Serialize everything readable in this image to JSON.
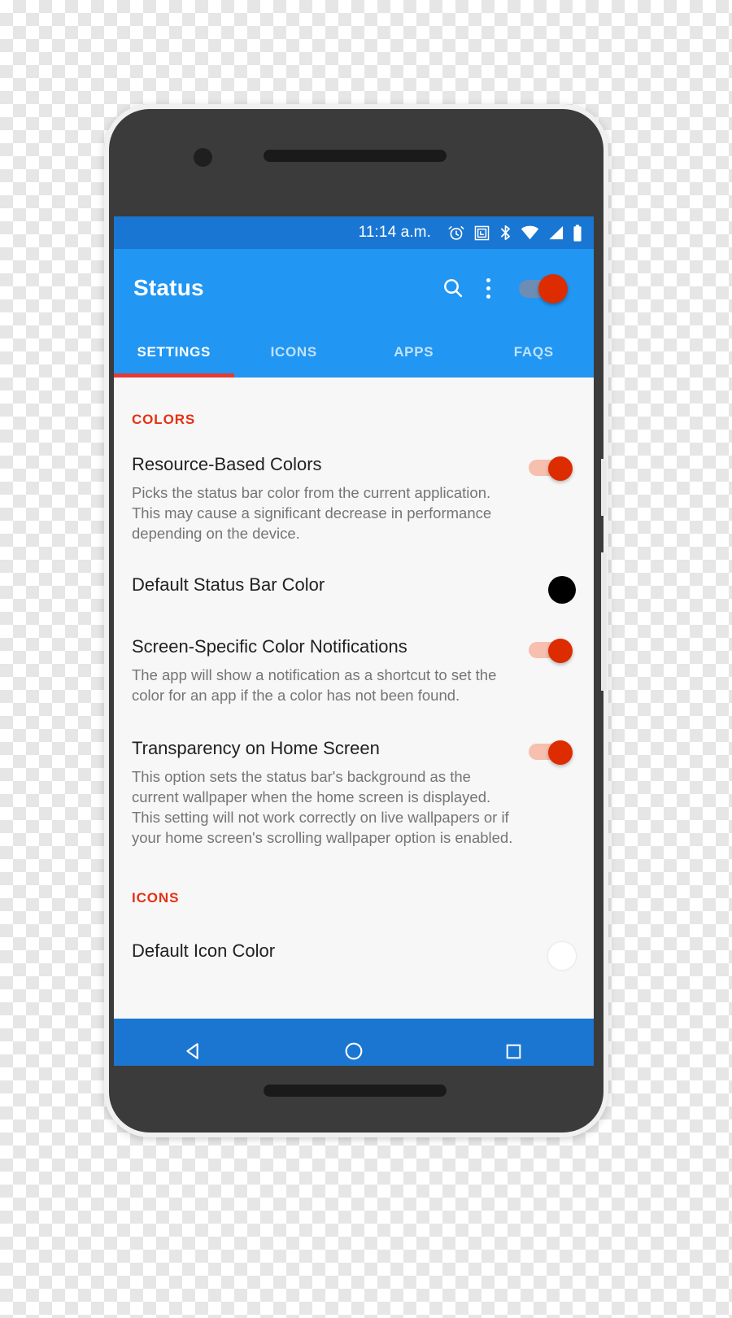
{
  "device": {
    "frame_color": "#3b3b3b",
    "frame_edge_color": "#f0f0f0"
  },
  "status_bar": {
    "time": "11:14 a.m.",
    "background": "#1976d2",
    "icons": [
      "alarm-icon",
      "nfc-icon",
      "bluetooth-icon",
      "wifi-icon",
      "signal-icon",
      "battery-icon"
    ]
  },
  "app_bar": {
    "title": "Status",
    "background": "#2196f3",
    "search_icon": "search-icon",
    "overflow_icon": "more-vert-icon",
    "master_switch": {
      "state": "on",
      "track_color": "#6d8db4",
      "thumb_color": "#dd2c00"
    }
  },
  "tabs": {
    "active_index": 0,
    "indicator_color": "#e53935",
    "items": [
      {
        "label": "SETTINGS"
      },
      {
        "label": "ICONS"
      },
      {
        "label": "APPS"
      },
      {
        "label": "FAQS"
      }
    ]
  },
  "settings": {
    "accent_color": "#e53113",
    "sections": [
      {
        "header": "COLORS",
        "items": [
          {
            "title": "Resource-Based Colors",
            "summary": "Picks the status bar color from the current application. This may cause a significant decrease in performance depending on the device.",
            "control": "switch",
            "state": "on"
          },
          {
            "title": "Default Status Bar Color",
            "summary": "",
            "control": "color",
            "value": "#000000"
          },
          {
            "title": "Screen-Specific Color Notifications",
            "summary": "The app will show a notification as a shortcut to set the color for an app if the a color has not been found.",
            "control": "switch",
            "state": "on"
          },
          {
            "title": "Transparency on Home Screen",
            "summary": "This option sets the status bar's background as the current wallpaper when the home screen is displayed. This setting will not work correctly on live wallpapers or if your home screen's scrolling wallpaper option is enabled.",
            "control": "switch",
            "state": "on"
          }
        ]
      },
      {
        "header": "ICONS",
        "items": [
          {
            "title": "Default Icon Color",
            "summary": "",
            "control": "color",
            "value": "#ffffff"
          }
        ]
      }
    ]
  },
  "nav_bar": {
    "background": "#1b76d1",
    "buttons": [
      {
        "name": "back-button",
        "icon": "back-triangle-icon"
      },
      {
        "name": "home-button",
        "icon": "home-circle-icon"
      },
      {
        "name": "recents-button",
        "icon": "recents-square-icon"
      }
    ]
  }
}
